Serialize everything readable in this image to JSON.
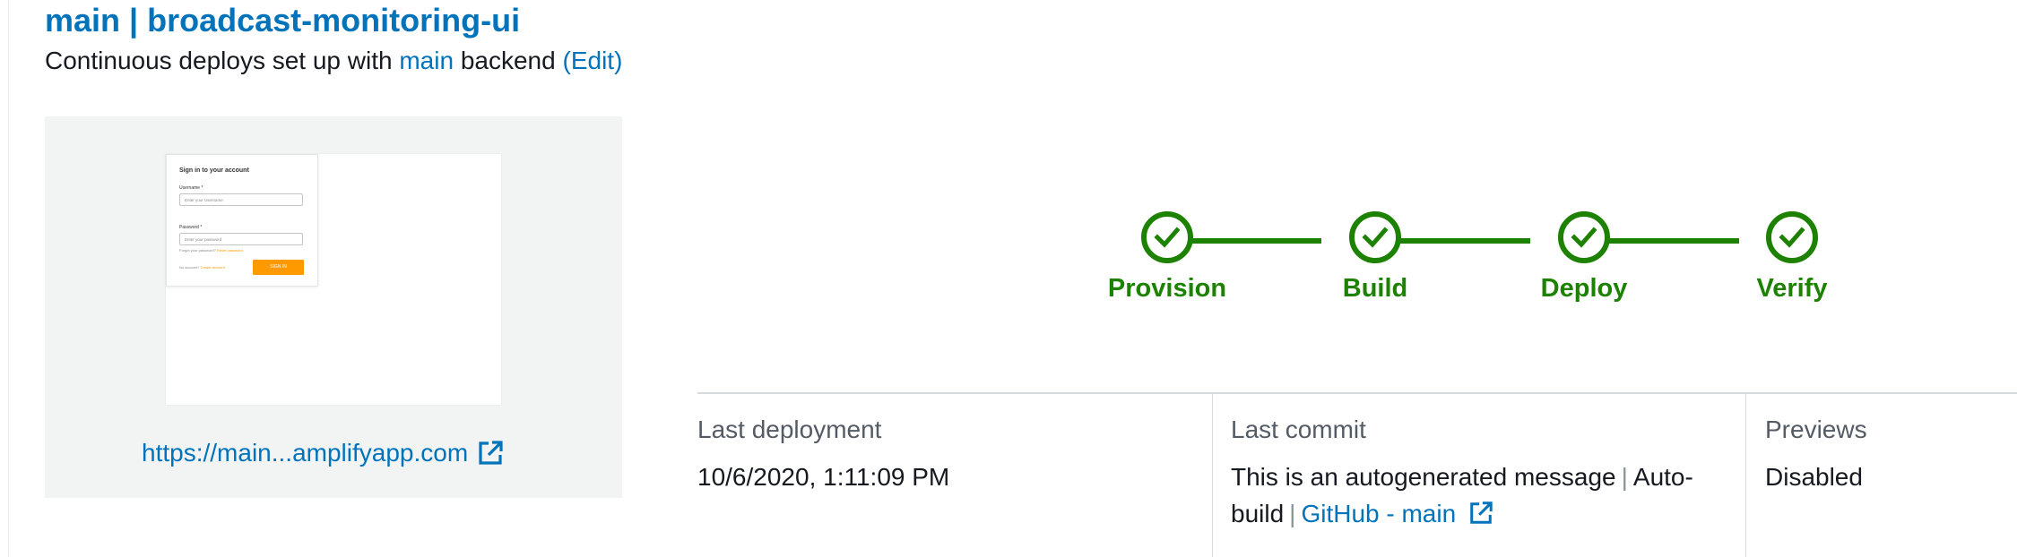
{
  "header": {
    "title": "main | broadcast-monitoring-ui",
    "subtitle_prefix": "Continuous deploys set up with",
    "backend_link": "main",
    "subtitle_suffix": "backend",
    "edit_link": "(Edit)"
  },
  "preview": {
    "login_title": "Sign in to your account",
    "username_label": "Username *",
    "username_placeholder": "Enter your Username",
    "password_label": "Password *",
    "password_placeholder": "Enter your password",
    "forgot_text": "Forgot your password?",
    "reset_link": "Reset password",
    "no_account_text": "No account?",
    "create_link": "Create account",
    "sign_in_button": "SIGN IN",
    "url": "https://main...amplifyapp.com"
  },
  "pipeline": {
    "status_color": "#1d8102",
    "steps": [
      {
        "label": "Provision",
        "status": "complete"
      },
      {
        "label": "Build",
        "status": "complete"
      },
      {
        "label": "Deploy",
        "status": "complete"
      },
      {
        "label": "Verify",
        "status": "complete"
      }
    ]
  },
  "summary": {
    "last_deployment": {
      "label": "Last deployment",
      "value": "10/6/2020, 1:11:09 PM"
    },
    "last_commit": {
      "label": "Last commit",
      "message": "This is an autogenerated message",
      "trigger": "Auto-build",
      "repo_link": "GitHub - main"
    },
    "previews": {
      "label": "Previews",
      "value": "Disabled"
    }
  },
  "icons": {
    "external_link": "external-link-icon",
    "check": "check-icon"
  }
}
